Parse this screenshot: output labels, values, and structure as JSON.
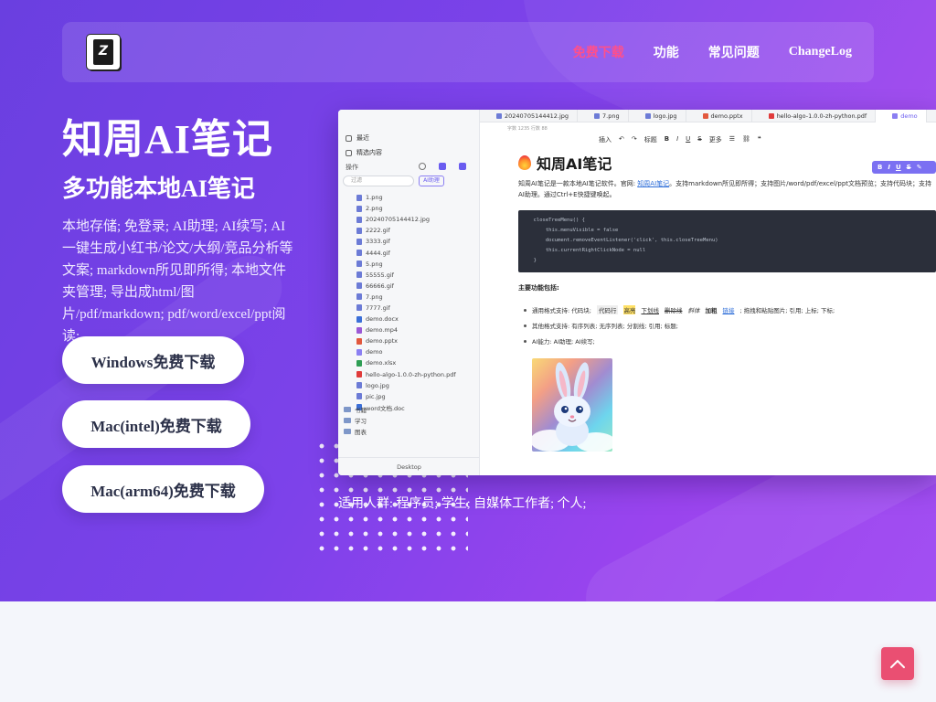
{
  "nav": {
    "links": [
      {
        "label": "免费下载",
        "active": true
      },
      {
        "label": "功能",
        "active": false
      },
      {
        "label": "常见问题",
        "active": false
      },
      {
        "label": "ChangeLog",
        "active": false
      }
    ]
  },
  "hero": {
    "title": "知周AI笔记",
    "subtitle": "多功能本地AI笔记",
    "description": "本地存储; 免登录; AI助理; AI续写; AI一键生成小红书/论文/大纲/竞品分析等文案; markdown所见即所得; 本地文件夹管理; 导出成html/图片/pdf/markdown; pdf/word/excel/ppt阅读;",
    "buttons": [
      "Windows免费下载",
      "Mac(intel)免费下载",
      "Mac(arm64)免费下载"
    ],
    "audience": "适用人群: 程序员; 学生; 自媒体工作者; 个人;"
  },
  "app": {
    "sidebar": {
      "items": [
        "最近",
        "精选内容"
      ],
      "toolbar_label": "操作",
      "search_placeholder": "过滤",
      "ai_button": "AI助理",
      "files": [
        {
          "name": "1.png",
          "color": "#6c7bd6"
        },
        {
          "name": "2.png",
          "color": "#6c7bd6"
        },
        {
          "name": "20240705144412.jpg",
          "color": "#6c7bd6"
        },
        {
          "name": "2222.gif",
          "color": "#6c7bd6"
        },
        {
          "name": "3333.gif",
          "color": "#6c7bd6"
        },
        {
          "name": "4444.gif",
          "color": "#6c7bd6"
        },
        {
          "name": "5.png",
          "color": "#6c7bd6"
        },
        {
          "name": "55555.gif",
          "color": "#6c7bd6"
        },
        {
          "name": "66666.gif",
          "color": "#6c7bd6"
        },
        {
          "name": "7.png",
          "color": "#6c7bd6"
        },
        {
          "name": "7777.gif",
          "color": "#6c7bd6"
        },
        {
          "name": "demo.docx",
          "color": "#3b6fd8"
        },
        {
          "name": "demo.mp4",
          "color": "#9b59d6"
        },
        {
          "name": "demo.pptx",
          "color": "#e2583e"
        },
        {
          "name": "demo",
          "color": "#8b7ff2"
        },
        {
          "name": "demo.xlsx",
          "color": "#2f9e55"
        },
        {
          "name": "hello-algo-1.0.0-zh-python.pdf",
          "color": "#e03b3b"
        },
        {
          "name": "logo.jpg",
          "color": "#6c7bd6"
        },
        {
          "name": "pic.jpg",
          "color": "#6c7bd6"
        },
        {
          "name": "word文档.doc",
          "color": "#3b6fd8"
        }
      ],
      "folders": [
        "书籍",
        "学习",
        "图表"
      ],
      "bottom": "Desktop"
    },
    "tabs": [
      "20240705144412.jpg",
      "7.png",
      "logo.jpg",
      "demo.pptx",
      "hello-algo-1.0.0-zh-python.pdf",
      "demo"
    ],
    "info_row": "字数 1235   行数 88",
    "toolbar": [
      "插入",
      "标题",
      "B",
      "I",
      "U",
      "S",
      "更多"
    ],
    "float_toolbar": [
      "B",
      "I",
      "U",
      "S"
    ],
    "doc": {
      "title": "知周AI笔记",
      "intro_before": "知周AI笔记是一款本地AI笔记软件。官网: ",
      "intro_link": "知周AI笔记",
      "intro_after": "。支持markdown所见即所得；支持图片/word/pdf/excel/ppt文档预览；支持代码块；支持AI助理。通过Ctrl+E快捷键唤起。",
      "code": "  closeTreeMenu() {\n      this.menuVisible = false\n      document.removeEventListener('click', this.closeTreeMenu)\n      this.currentRightClickNode = null\n  }",
      "section_heading": "主要功能包括:",
      "bullets": [
        {
          "prefix": "通用格式支持: 代码块; ",
          "code": "代码行",
          "hl": "高亮",
          "ul": "下划线",
          "st": "删除线",
          "it": "斜体",
          "bd": "加粗",
          "lk": "链接",
          "suffix": "; 拖拽和粘贴图片; 引用; 上标; 下标;"
        },
        {
          "text": "其他格式支持: 有序列表; 无序列表; 分割线; 引用; 标题;"
        },
        {
          "text": "AI能力: AI助理; AI续写;"
        }
      ]
    }
  },
  "colors": {
    "accent": "#ff4f8b",
    "primary": "#7d42ea",
    "to_top": "#ea4f72"
  }
}
